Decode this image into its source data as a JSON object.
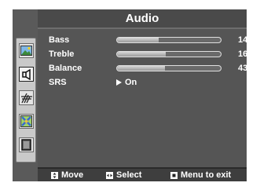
{
  "header": {
    "title": "Audio"
  },
  "menu_icons": [
    {
      "name": "picture-icon"
    },
    {
      "name": "audio-icon"
    },
    {
      "name": "antenna-icon"
    },
    {
      "name": "tools-icon"
    },
    {
      "name": "screen-icon"
    }
  ],
  "settings": {
    "bass": {
      "label": "Bass",
      "value": "14",
      "level": 0.4
    },
    "treble": {
      "label": "Treble",
      "value": "16",
      "level": 0.47
    },
    "balance": {
      "label": "Balance",
      "value": "43",
      "level": 0.46
    },
    "srs": {
      "label": "SRS",
      "value": "On"
    }
  },
  "footer": {
    "move_label": "Move",
    "select_label": "Select",
    "exit_label": "Menu to exit"
  },
  "colors": {
    "osd_bg": "#4a4a4a",
    "text": "#ffffff",
    "icon_strip": "#c9c9c9"
  }
}
